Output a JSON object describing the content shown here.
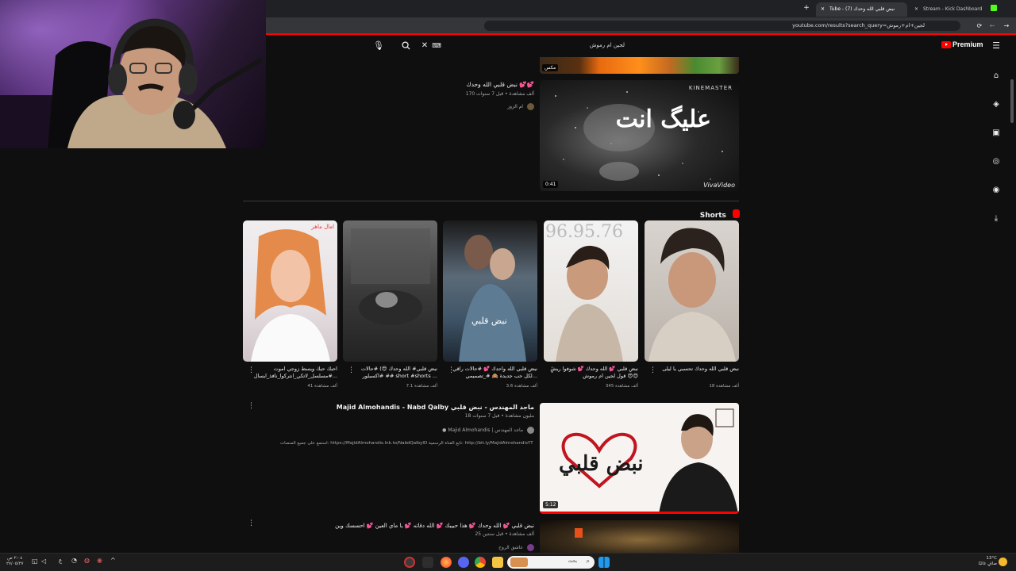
{
  "browser": {
    "tabs": [
      {
        "label": "Tube - (7) نبض قلبي الله وحدك",
        "active": true
      },
      {
        "label": "Stream - Kick Dashboard",
        "active": false
      }
    ],
    "address": "youtube.com/results?search_query=لجين+ام+رموش"
  },
  "search": {
    "query": "لجين ام رموش"
  },
  "premium_label": "Premium",
  "top_partial": {
    "channel_badge": "مكس"
  },
  "video1": {
    "title": "نبض قلبي الله وحدك 💕💕",
    "meta": "170 ألف مشاهدة • قبل 7 سنوات",
    "channel": "ام الزوز",
    "duration": "0:41",
    "overlay_text": "عليگ انت",
    "watermark_top": "KINEMASTER",
    "watermark_bottom": "VivaVideo"
  },
  "shorts_header": "Shorts",
  "shorts": [
    {
      "title": "نبض قلبي 💕 الله وحدك 💕 شوفوا ريش قول لجين ام رموش 😍😍",
      "views": "345 ألف مشاهدة"
    },
    {
      "title": "نبض قلبي الله واحدك 💕 #حالات راقي لكل حب جديدة 🙈 #_تصميمي...",
      "views": "3.6 ألف مشاهدة"
    },
    {
      "title": "نبض قلبي# الله وحدك 😍) #حالات #اكسبلور ## short #shorts ...",
      "views": "7.1 ألف مشاهدة"
    },
    {
      "title": "احبك حبك ويسط زوجي اموت #مسلسل_لاتكي_انتركوا_نافذ_ايسال...",
      "views": "41 ألف مشاهدة"
    },
    {
      "title": "نبض قلبي الله وحدك تحسبي يا ليلى",
      "views": "18 ألف مشاهدة"
    }
  ],
  "shorts_overlays": [
    "96.95.76",
    "نبض قلبي",
    "امال ماهر"
  ],
  "video2": {
    "title": "Majid Almohandis - Nabd Qalby ماجد المهندس - نبض قلبي",
    "meta": "18 مليون مشاهدة • قبل 7 سنوات",
    "channel": "Majid Almohandis | ماجد المهندس",
    "desc": "استمع على جميع المنصات: https://MajidAlmohandis.lnk.to/NabdQalbyID تابع القناة الرسمية: http://bit.ly/MajidAlmohandisYT ...",
    "duration": "5:12",
    "thumb_text": "نبض قلبي"
  },
  "video3": {
    "title": "نبض قلبي 💕 الله وحدك 💕 هذا حبيبك 💕 الله دقاته 💕 يا ماي العين 💕 احسسك وين",
    "meta": "25 ألف مشاهدة • قبل سنتين",
    "channel": "عاشق الروح"
  },
  "taskbar": {
    "search_text": "بحث",
    "weather": "13°C",
    "weather_sub": "صافٍ غالبًا",
    "time": "٢:٠٤ ص",
    "date": "٢٧/٠٥/٢٧",
    "lang": "ع"
  },
  "colors": {
    "accent": "#ff0000",
    "bg": "#0f0f0f"
  }
}
